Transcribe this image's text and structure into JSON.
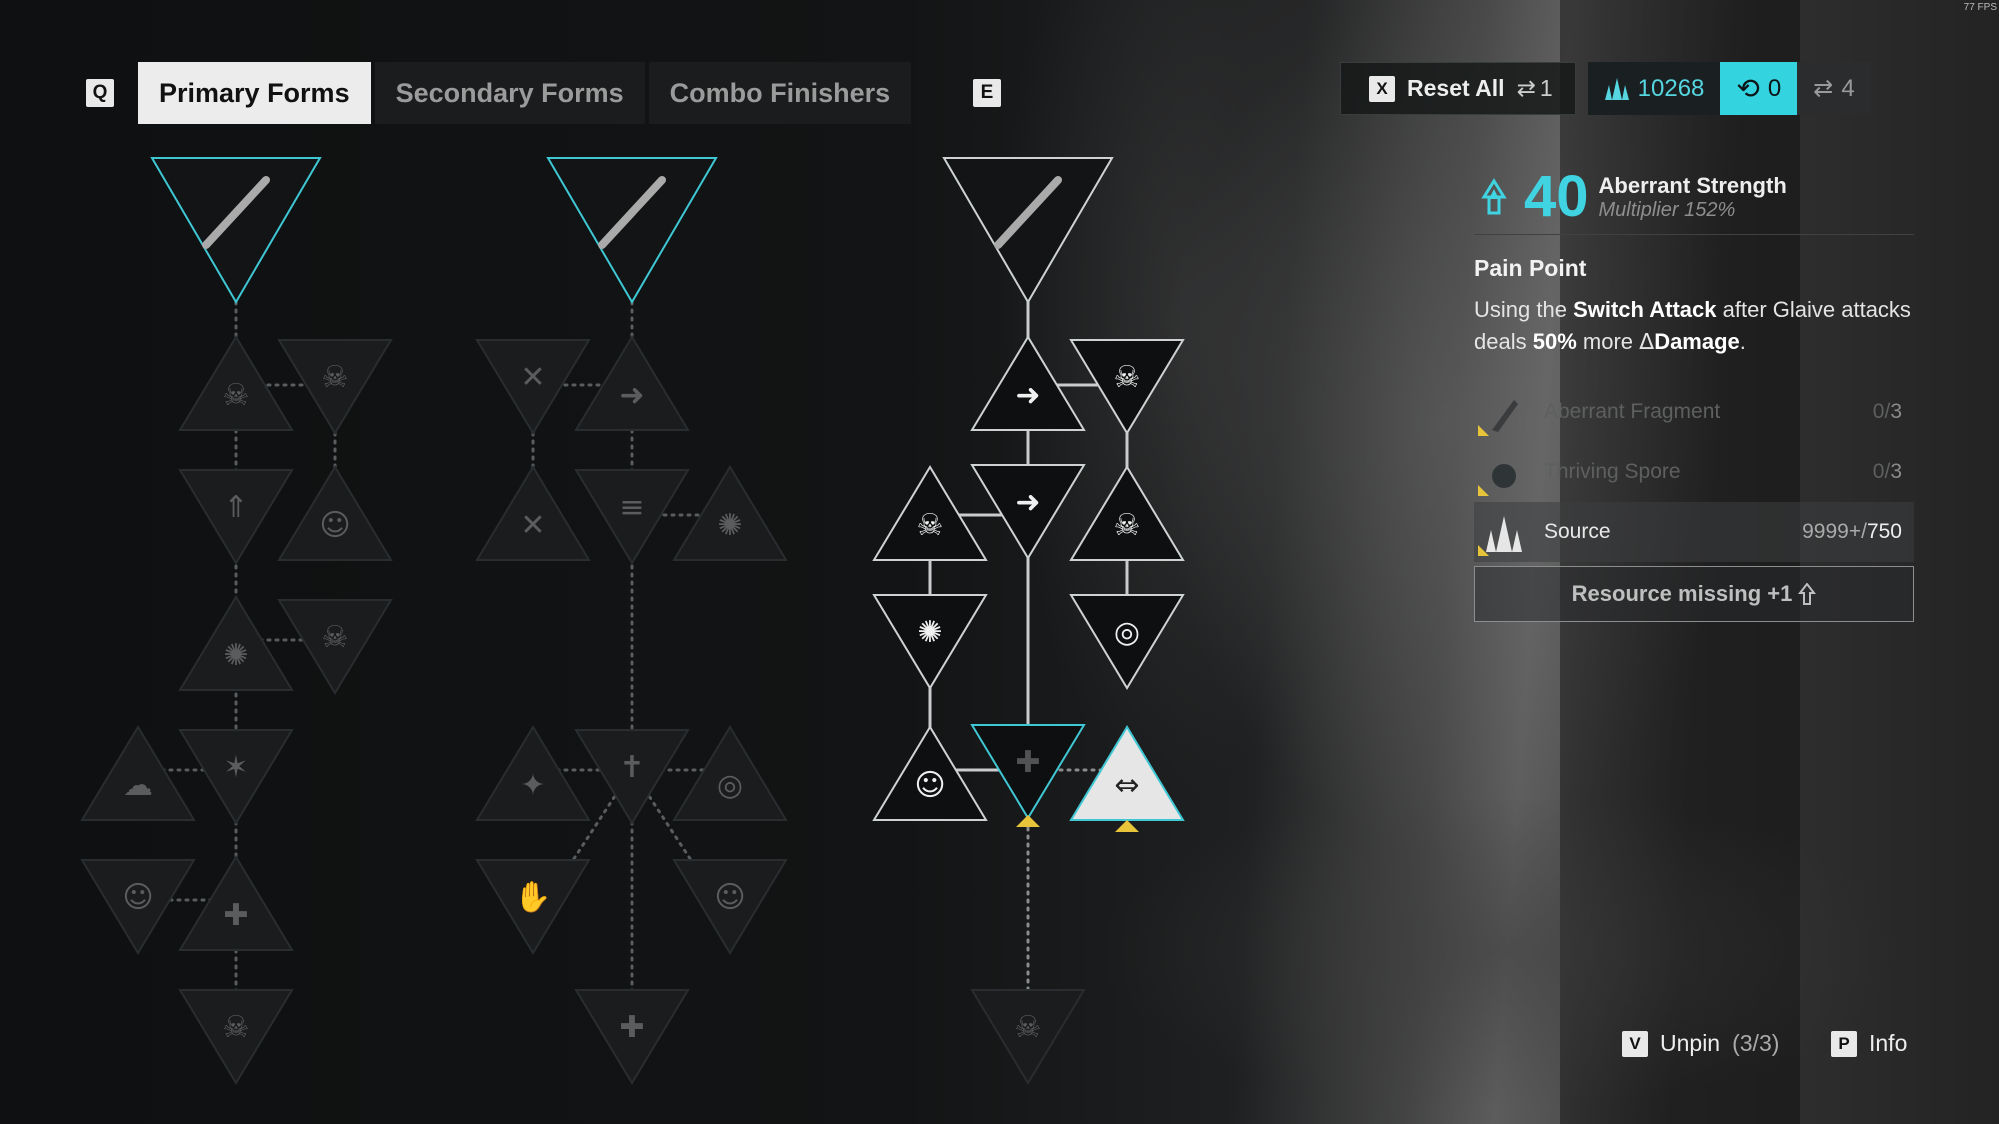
{
  "fps": "77 FPS",
  "tabs": {
    "prev_key": "Q",
    "next_key": "E",
    "items": [
      {
        "label": "Primary Forms",
        "active": true
      },
      {
        "label": "Secondary Forms",
        "active": false
      },
      {
        "label": "Combo Finishers",
        "active": false
      }
    ]
  },
  "topbar": {
    "reset_key": "X",
    "reset_label": "Reset All",
    "reset_count": "1",
    "currency_a": "10268",
    "currency_b": "0",
    "currency_c": "4"
  },
  "info": {
    "level": "40",
    "name": "Aberrant Strength",
    "multiplier": "Multiplier 152%",
    "perk_title": "Pain Point",
    "desc_1": "Using the ",
    "desc_b1": "Switch Attack",
    "desc_2": " after Glaive attacks deals ",
    "desc_b2": "50%",
    "desc_3": " more ",
    "desc_b3": "Damage",
    "desc_4": ".",
    "resources": [
      {
        "label": "Aberrant Fragment",
        "have": "0",
        "need": "3",
        "available": false
      },
      {
        "label": "Thriving Spore",
        "have": "0",
        "need": "3",
        "available": false
      },
      {
        "label": "Source",
        "have": "9999+",
        "need": "750",
        "available": true
      }
    ],
    "missing_label": "Resource missing +1"
  },
  "footer": {
    "unpin_key": "V",
    "unpin_label": "Unpin",
    "unpin_count": "(3/3)",
    "info_key": "P",
    "info_label": "Info"
  },
  "colors": {
    "accent": "#40d4e2",
    "warning": "#e8c43a"
  }
}
